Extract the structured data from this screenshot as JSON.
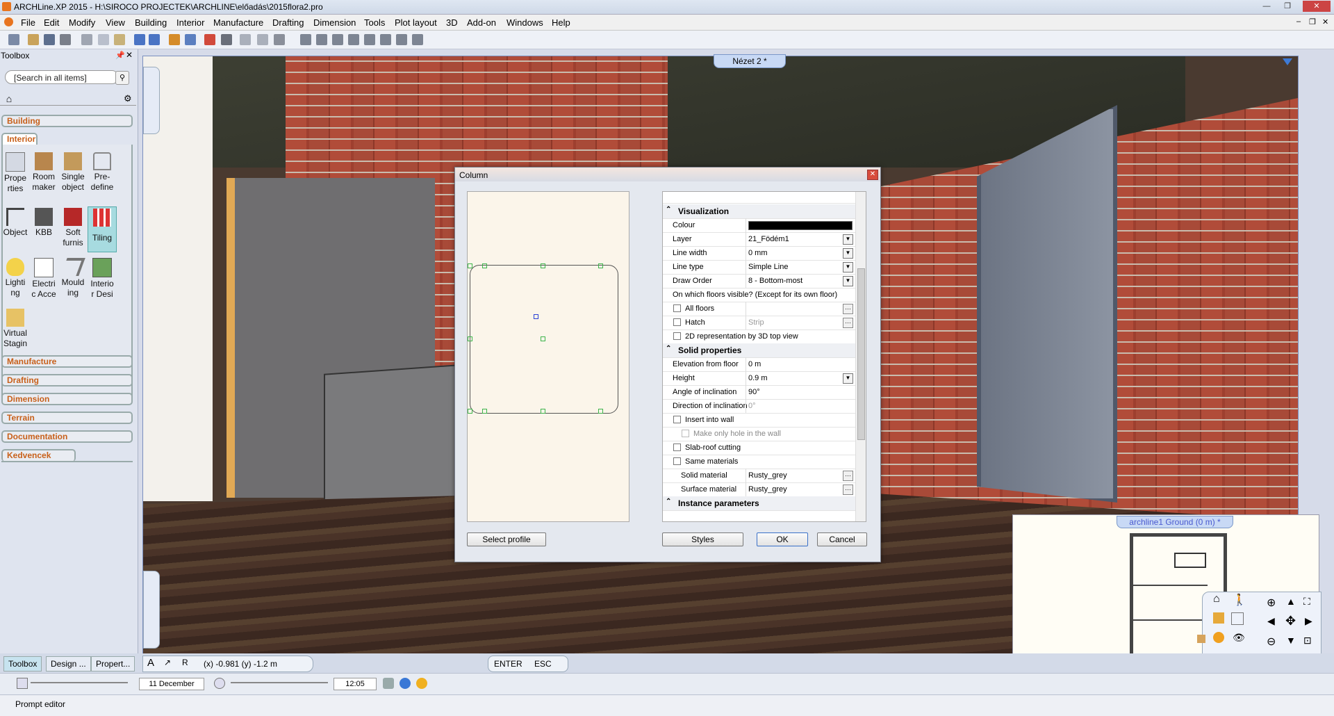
{
  "window": {
    "title": "ARCHLine.XP 2015 - H:\\SIROCO PROJECTEK\\ARCHLINE\\előadás\\2015flora2.pro"
  },
  "menu": [
    "File",
    "Edit",
    "Modify",
    "View",
    "Building",
    "Interior",
    "Manufacture",
    "Drafting",
    "Dimension",
    "Tools",
    "Plot layout",
    "3D",
    "Add-on",
    "Windows",
    "Help"
  ],
  "toolbox": {
    "title": "Toolbox",
    "search_placeholder": "[Search in all items]",
    "categories": {
      "building": "Building",
      "interior": "Interior",
      "manufacture": "Manufacture",
      "drafting": "Drafting",
      "dimension": "Dimension",
      "terrain": "Terrain",
      "documentation": "Documentation",
      "kedvencek": "Kedvencek"
    },
    "tools": [
      {
        "label": "Prope rties"
      },
      {
        "label": "Room maker"
      },
      {
        "label": "Single object"
      },
      {
        "label": "Pre-define"
      },
      {
        "label": "Object"
      },
      {
        "label": "KBB"
      },
      {
        "label": "Soft furnis"
      },
      {
        "label": "Tiling"
      },
      {
        "label": "Lighti ng"
      },
      {
        "label": "Electri c Acce"
      },
      {
        "label": "Mould ing"
      },
      {
        "label": "Interio r Desi"
      },
      {
        "label": "Virtual Stagin"
      }
    ]
  },
  "viewport": {
    "tab": "Nézet 2 *"
  },
  "dialog": {
    "title": "Column",
    "groups": {
      "visualization": "Visualization",
      "solid": "Solid properties",
      "instance": "Instance parameters"
    },
    "props": {
      "colour": "Colour",
      "layer": "Layer",
      "layer_val": "21_Födém1",
      "linewidth": "Line width",
      "linewidth_val": "0 mm",
      "linetype": "Line type",
      "linetype_val": "Simple Line",
      "draworder": "Draw Order",
      "draworder_val": "8 - Bottom-most",
      "floors_q": "On which floors visible? (Except for its own floor)",
      "allfloors": "All floors",
      "hatch": "Hatch",
      "hatch_val": "Strip",
      "rep2d": "2D representation by 3D top view",
      "elev": "Elevation from floor",
      "elev_val": "0 m",
      "height": "Height",
      "height_val": "0.9 m",
      "angle": "Angle of inclination",
      "angle_val": "90°",
      "direction": "Direction of inclination",
      "direction_val": "0°",
      "insert": "Insert into wall",
      "hole": "Make only hole in the wall",
      "slab": "Slab-roof cutting",
      "same": "Same materials",
      "solidmat": "Solid material",
      "solidmat_val": "Rusty_grey",
      "surfmat": "Surface material",
      "surfmat_val": "Rusty_grey"
    },
    "buttons": {
      "select_profile": "Select profile",
      "styles": "Styles",
      "ok": "OK",
      "cancel": "Cancel"
    }
  },
  "minimap": {
    "tab": "archline1 Ground (0 m) *"
  },
  "status": {
    "tabs": [
      "Toolbox",
      "Design ...",
      "Propert..."
    ],
    "coords": "(x) -0.981   (y) -1.2 m",
    "enter": "ENTER",
    "esc": "ESC",
    "date": "11 December",
    "time": "12:05",
    "prompt": "Prompt editor"
  }
}
